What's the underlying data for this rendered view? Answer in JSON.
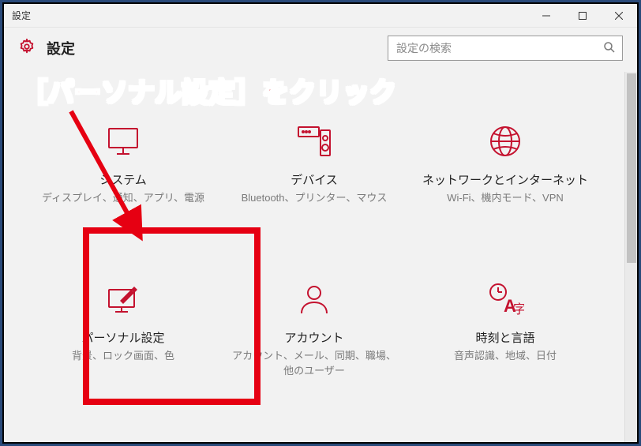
{
  "window": {
    "title": "設定"
  },
  "header": {
    "app_title": "設定"
  },
  "search": {
    "placeholder": "設定の検索",
    "value": ""
  },
  "tiles": [
    {
      "id": "system",
      "title": "システム",
      "desc": "ディスプレイ、通知、アプリ、電源"
    },
    {
      "id": "devices",
      "title": "デバイス",
      "desc": "Bluetooth、プリンター、マウス"
    },
    {
      "id": "network",
      "title": "ネットワークとインターネット",
      "desc": "Wi-Fi、機内モード、VPN"
    },
    {
      "id": "personalization",
      "title": "パーソナル設定",
      "desc": "背景、ロック画面、色"
    },
    {
      "id": "accounts",
      "title": "アカウント",
      "desc": "アカウント、メール、同期、職場、他のユーザー"
    },
    {
      "id": "time",
      "title": "時刻と言語",
      "desc": "音声認識、地域、日付"
    }
  ],
  "annotation": {
    "text": "［パーソナル設定］をクリック"
  },
  "colors": {
    "accent": "#c4122f",
    "annotation": "#e60012"
  }
}
